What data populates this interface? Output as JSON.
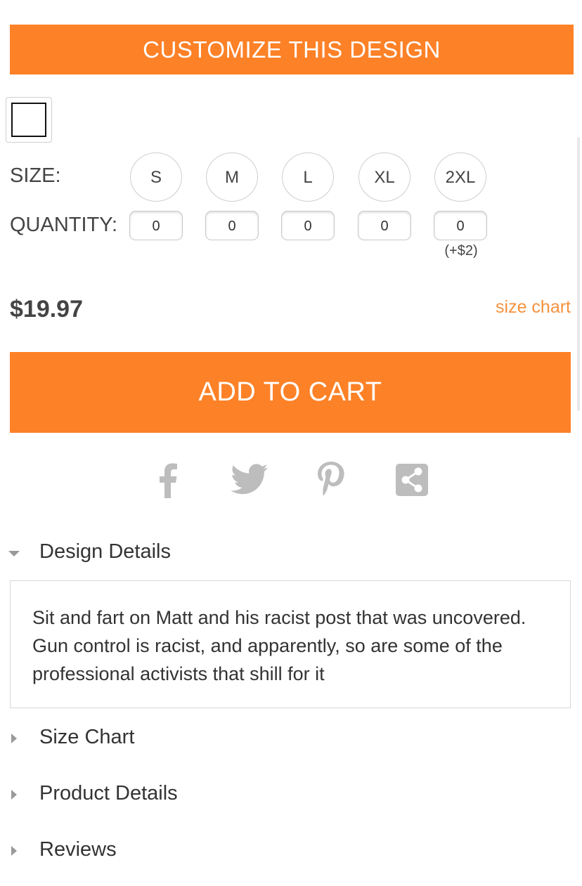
{
  "customize_button": "CUSTOMIZE THIS DESIGN",
  "size": {
    "label": "SIZE:",
    "options": [
      "S",
      "M",
      "L",
      "XL",
      "2XL"
    ]
  },
  "quantity": {
    "label": "QUANTITY:",
    "values": [
      "0",
      "0",
      "0",
      "0",
      "0"
    ],
    "surcharge_2xl": "(+$2)"
  },
  "price": "$19.97",
  "size_chart_link": "size chart",
  "add_to_cart": "ADD TO CART",
  "social_icons": [
    "facebook-icon",
    "twitter-icon",
    "pinterest-icon",
    "share-icon"
  ],
  "accordion": {
    "design_details": {
      "title": "Design Details",
      "body": "Sit and fart on Matt and his racist post that was uncovered. Gun control is racist, and apparently, so are some of the professional activists that shill for it"
    },
    "size_chart": {
      "title": "Size Chart"
    },
    "product_details": {
      "title": "Product Details"
    },
    "reviews": {
      "title": "Reviews"
    }
  },
  "colors": {
    "accent": "#fd8127",
    "link": "#f5923e",
    "icon_gray": "#bdbdbd",
    "text": "#333333"
  }
}
